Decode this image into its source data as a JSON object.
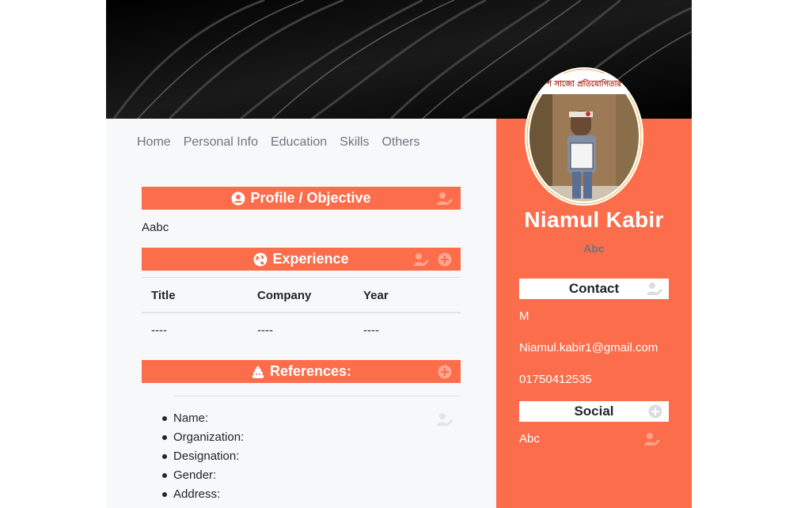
{
  "nav": {
    "items": [
      "Home",
      "Personal Info",
      "Education",
      "Skills",
      "Others"
    ]
  },
  "profile": {
    "name": "Niamul Kabir",
    "tagline": "Abc",
    "photo_caption": "শ সাজো প্রতিযোগিতার"
  },
  "objective": {
    "heading": "Profile / Objective",
    "text": "Aabc"
  },
  "experience": {
    "heading": "Experience",
    "columns": [
      "Title",
      "Company",
      "Year"
    ],
    "rows": [
      [
        "----",
        "----",
        "----"
      ]
    ]
  },
  "references": {
    "heading": "References:",
    "fields": [
      "Name:",
      "Organization:",
      "Designation:",
      "Gender:",
      "Address:"
    ]
  },
  "contact": {
    "heading": "Contact",
    "gender": "M",
    "email": "Niamul.kabir1@gmail.com",
    "phone": "01750412535"
  },
  "social": {
    "heading": "Social",
    "text": "Abc"
  },
  "colors": {
    "accent": "#fc6d4b",
    "muted": "#6c757d",
    "background": "#f7f8fa"
  }
}
